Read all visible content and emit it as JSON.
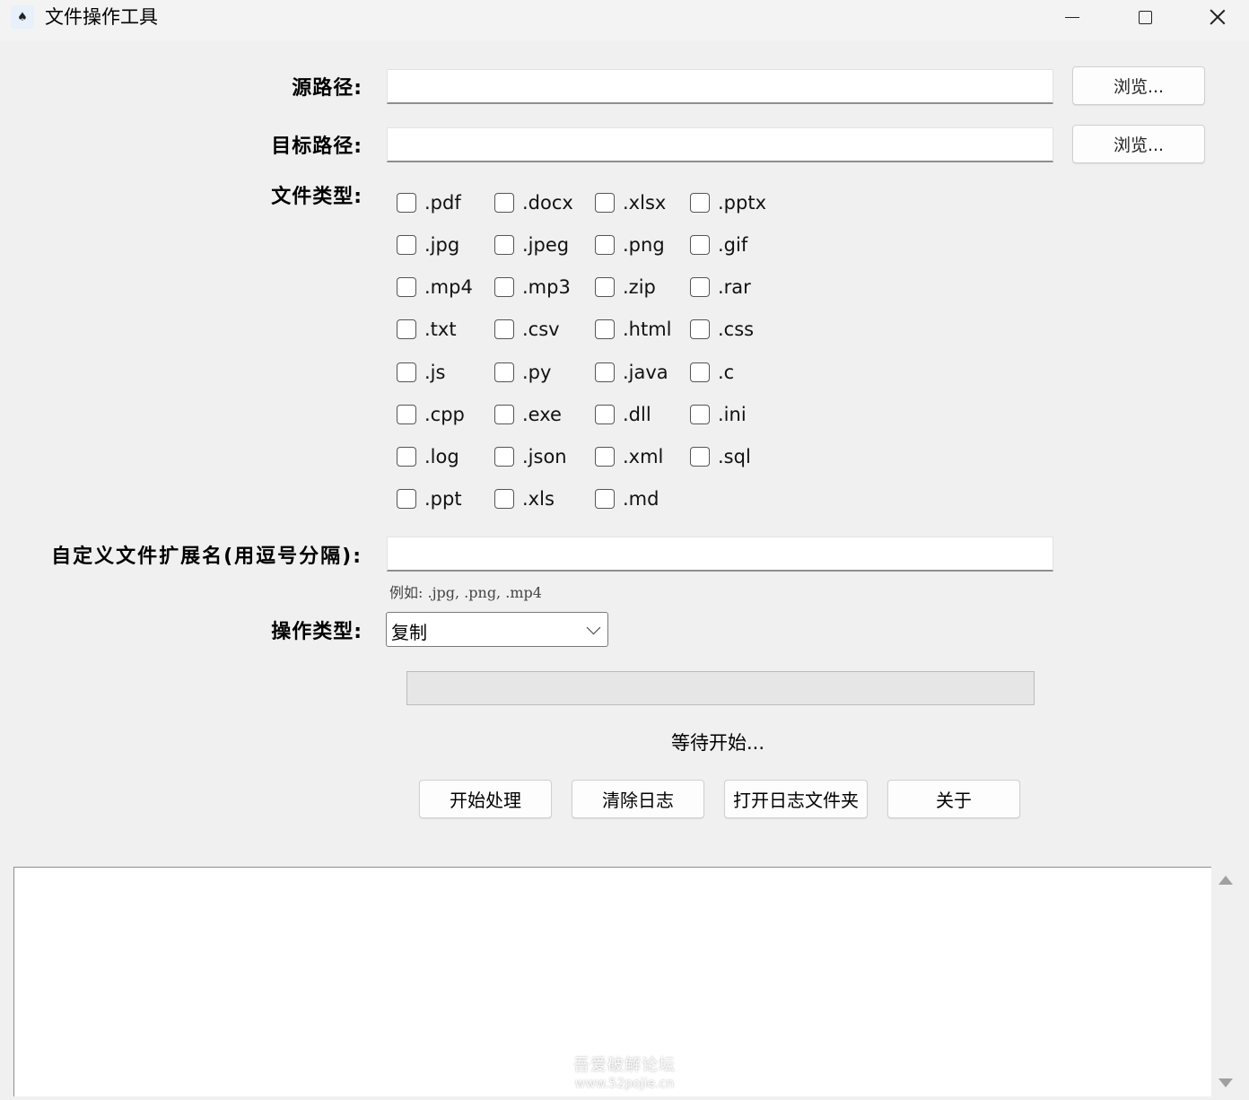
{
  "window": {
    "title": "文件操作工具",
    "icon": "app-icon"
  },
  "source": {
    "label": "源路径:",
    "value": "",
    "browse_label": "浏览..."
  },
  "target": {
    "label": "目标路径:",
    "value": "",
    "browse_label": "浏览..."
  },
  "file_types": {
    "label": "文件类型:",
    "items": [
      ".pdf",
      ".docx",
      ".xlsx",
      ".pptx",
      ".jpg",
      ".jpeg",
      ".png",
      ".gif",
      ".mp4",
      ".mp3",
      ".zip",
      ".rar",
      ".txt",
      ".csv",
      ".html",
      ".css",
      ".js",
      ".py",
      ".java",
      ".c",
      ".cpp",
      ".exe",
      ".dll",
      ".ini",
      ".log",
      ".json",
      ".xml",
      ".sql",
      ".ppt",
      ".xls",
      ".md"
    ]
  },
  "custom_ext": {
    "label": "自定义文件扩展名(用逗号分隔):",
    "value": "",
    "hint": "例如: .jpg, .png, .mp4"
  },
  "operation": {
    "label": "操作类型:",
    "selected": "复制"
  },
  "progress": {
    "percent": 0
  },
  "status_text": "等待开始...",
  "buttons": {
    "start": "开始处理",
    "clear_log": "清除日志",
    "open_log_folder": "打开日志文件夹",
    "about": "关于"
  },
  "log": {
    "content": ""
  },
  "watermark": {
    "line1": "吾爱破解论坛",
    "line2": "www.52pojie.cn"
  }
}
